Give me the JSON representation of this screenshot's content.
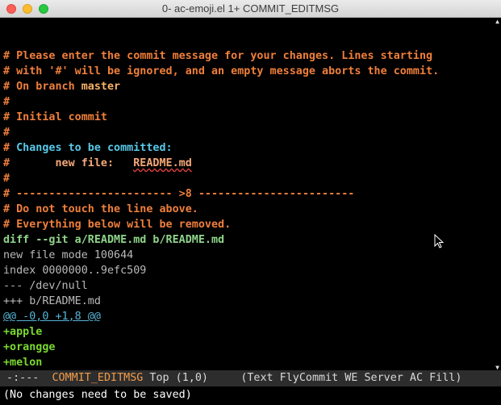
{
  "window": {
    "title": "0- ac-emoji.el 1+ COMMIT_EDITMSG"
  },
  "editor": {
    "lines": [
      {
        "type": "comment",
        "text": "# Please enter the commit message for your changes. Lines starting"
      },
      {
        "type": "comment",
        "text": "# with '#' will be ignored, and an empty message aborts the commit."
      },
      {
        "type": "comment_branch",
        "prefix": "# On branch ",
        "branch": "master"
      },
      {
        "type": "comment",
        "text": "#"
      },
      {
        "type": "comment",
        "text": "# Initial commit"
      },
      {
        "type": "comment",
        "text": "#"
      },
      {
        "type": "comment_heading",
        "prefix": "# ",
        "heading": "Changes to be committed:"
      },
      {
        "type": "comment_file",
        "prefix": "#\t",
        "status": "new file:",
        "file": "README.md"
      },
      {
        "type": "comment",
        "text": "#"
      },
      {
        "type": "comment",
        "text": "# ------------------------ >8 ------------------------"
      },
      {
        "type": "comment",
        "text": "# Do not touch the line above."
      },
      {
        "type": "comment",
        "text": "# Everything below will be removed."
      },
      {
        "type": "diff_header",
        "text": "diff --git a/README.md b/README.md"
      },
      {
        "type": "meta",
        "text": "new file mode 100644"
      },
      {
        "type": "meta",
        "text": "index 0000000..9efc509"
      },
      {
        "type": "meta",
        "text": "--- /dev/null"
      },
      {
        "type": "meta",
        "text": "+++ b/README.md"
      },
      {
        "type": "hunk",
        "text": "@@ -0,0 +1,8 @@"
      },
      {
        "type": "add",
        "text": "+apple"
      },
      {
        "type": "add",
        "text": "+orangge"
      },
      {
        "type": "add",
        "text": "+melon"
      }
    ]
  },
  "modeline": {
    "status": " -:---  ",
    "buffer": "COMMIT_EDITMSG",
    "position": " Top (1,0)     ",
    "modes": "(Text FlyCommit WE Server AC Fill)"
  },
  "minibuffer": {
    "message": "(No changes need to be saved)"
  },
  "colors": {
    "comment": "#ef7f3b",
    "heading": "#58c8e8",
    "diff_header": "#8fd48a",
    "added": "#7ad831",
    "modeline_bg": "#2d2d2d"
  },
  "icons": [
    "close-window-icon",
    "minimize-window-icon",
    "maximize-window-icon",
    "mouse-pointer-icon"
  ]
}
